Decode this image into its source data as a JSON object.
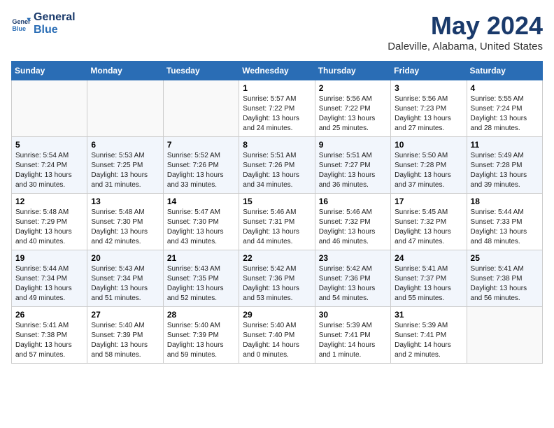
{
  "logo": {
    "line1": "General",
    "line2": "Blue"
  },
  "title": "May 2024",
  "subtitle": "Daleville, Alabama, United States",
  "days_header": [
    "Sunday",
    "Monday",
    "Tuesday",
    "Wednesday",
    "Thursday",
    "Friday",
    "Saturday"
  ],
  "weeks": [
    [
      {
        "day": "",
        "info": ""
      },
      {
        "day": "",
        "info": ""
      },
      {
        "day": "",
        "info": ""
      },
      {
        "day": "1",
        "info": "Sunrise: 5:57 AM\nSunset: 7:22 PM\nDaylight: 13 hours\nand 24 minutes."
      },
      {
        "day": "2",
        "info": "Sunrise: 5:56 AM\nSunset: 7:22 PM\nDaylight: 13 hours\nand 25 minutes."
      },
      {
        "day": "3",
        "info": "Sunrise: 5:56 AM\nSunset: 7:23 PM\nDaylight: 13 hours\nand 27 minutes."
      },
      {
        "day": "4",
        "info": "Sunrise: 5:55 AM\nSunset: 7:24 PM\nDaylight: 13 hours\nand 28 minutes."
      }
    ],
    [
      {
        "day": "5",
        "info": "Sunrise: 5:54 AM\nSunset: 7:24 PM\nDaylight: 13 hours\nand 30 minutes."
      },
      {
        "day": "6",
        "info": "Sunrise: 5:53 AM\nSunset: 7:25 PM\nDaylight: 13 hours\nand 31 minutes."
      },
      {
        "day": "7",
        "info": "Sunrise: 5:52 AM\nSunset: 7:26 PM\nDaylight: 13 hours\nand 33 minutes."
      },
      {
        "day": "8",
        "info": "Sunrise: 5:51 AM\nSunset: 7:26 PM\nDaylight: 13 hours\nand 34 minutes."
      },
      {
        "day": "9",
        "info": "Sunrise: 5:51 AM\nSunset: 7:27 PM\nDaylight: 13 hours\nand 36 minutes."
      },
      {
        "day": "10",
        "info": "Sunrise: 5:50 AM\nSunset: 7:28 PM\nDaylight: 13 hours\nand 37 minutes."
      },
      {
        "day": "11",
        "info": "Sunrise: 5:49 AM\nSunset: 7:28 PM\nDaylight: 13 hours\nand 39 minutes."
      }
    ],
    [
      {
        "day": "12",
        "info": "Sunrise: 5:48 AM\nSunset: 7:29 PM\nDaylight: 13 hours\nand 40 minutes."
      },
      {
        "day": "13",
        "info": "Sunrise: 5:48 AM\nSunset: 7:30 PM\nDaylight: 13 hours\nand 42 minutes."
      },
      {
        "day": "14",
        "info": "Sunrise: 5:47 AM\nSunset: 7:30 PM\nDaylight: 13 hours\nand 43 minutes."
      },
      {
        "day": "15",
        "info": "Sunrise: 5:46 AM\nSunset: 7:31 PM\nDaylight: 13 hours\nand 44 minutes."
      },
      {
        "day": "16",
        "info": "Sunrise: 5:46 AM\nSunset: 7:32 PM\nDaylight: 13 hours\nand 46 minutes."
      },
      {
        "day": "17",
        "info": "Sunrise: 5:45 AM\nSunset: 7:32 PM\nDaylight: 13 hours\nand 47 minutes."
      },
      {
        "day": "18",
        "info": "Sunrise: 5:44 AM\nSunset: 7:33 PM\nDaylight: 13 hours\nand 48 minutes."
      }
    ],
    [
      {
        "day": "19",
        "info": "Sunrise: 5:44 AM\nSunset: 7:34 PM\nDaylight: 13 hours\nand 49 minutes."
      },
      {
        "day": "20",
        "info": "Sunrise: 5:43 AM\nSunset: 7:34 PM\nDaylight: 13 hours\nand 51 minutes."
      },
      {
        "day": "21",
        "info": "Sunrise: 5:43 AM\nSunset: 7:35 PM\nDaylight: 13 hours\nand 52 minutes."
      },
      {
        "day": "22",
        "info": "Sunrise: 5:42 AM\nSunset: 7:36 PM\nDaylight: 13 hours\nand 53 minutes."
      },
      {
        "day": "23",
        "info": "Sunrise: 5:42 AM\nSunset: 7:36 PM\nDaylight: 13 hours\nand 54 minutes."
      },
      {
        "day": "24",
        "info": "Sunrise: 5:41 AM\nSunset: 7:37 PM\nDaylight: 13 hours\nand 55 minutes."
      },
      {
        "day": "25",
        "info": "Sunrise: 5:41 AM\nSunset: 7:38 PM\nDaylight: 13 hours\nand 56 minutes."
      }
    ],
    [
      {
        "day": "26",
        "info": "Sunrise: 5:41 AM\nSunset: 7:38 PM\nDaylight: 13 hours\nand 57 minutes."
      },
      {
        "day": "27",
        "info": "Sunrise: 5:40 AM\nSunset: 7:39 PM\nDaylight: 13 hours\nand 58 minutes."
      },
      {
        "day": "28",
        "info": "Sunrise: 5:40 AM\nSunset: 7:39 PM\nDaylight: 13 hours\nand 59 minutes."
      },
      {
        "day": "29",
        "info": "Sunrise: 5:40 AM\nSunset: 7:40 PM\nDaylight: 14 hours\nand 0 minutes."
      },
      {
        "day": "30",
        "info": "Sunrise: 5:39 AM\nSunset: 7:41 PM\nDaylight: 14 hours\nand 1 minute."
      },
      {
        "day": "31",
        "info": "Sunrise: 5:39 AM\nSunset: 7:41 PM\nDaylight: 14 hours\nand 2 minutes."
      },
      {
        "day": "",
        "info": ""
      }
    ]
  ]
}
